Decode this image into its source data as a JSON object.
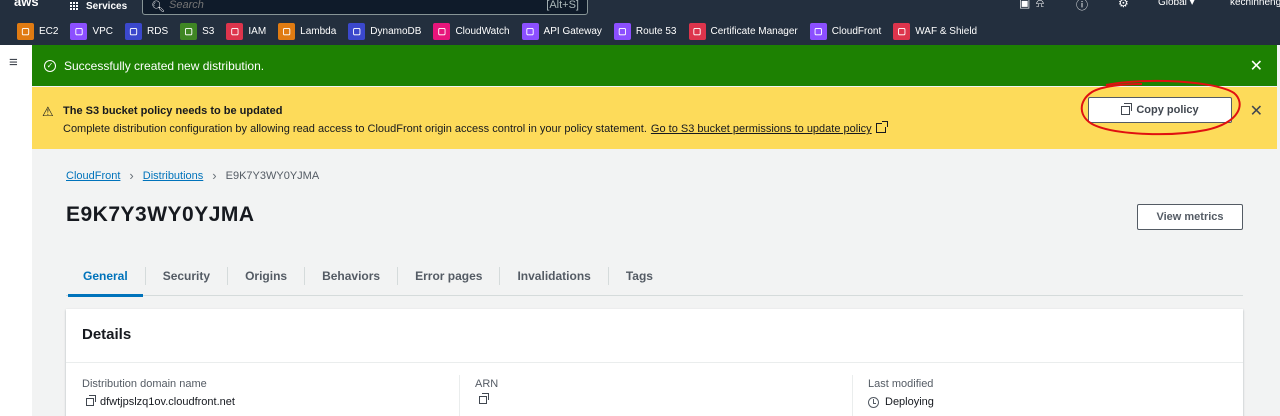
{
  "topnav": {
    "logo": "aws",
    "services_label": "Services",
    "search_placeholder": "Search",
    "search_shortcut": "[Alt+S]",
    "region_label": "Global ▾",
    "user_label": "kechihheng"
  },
  "favorites": [
    {
      "label": "EC2",
      "icon": "ec2-icon",
      "color": "#e07b12"
    },
    {
      "label": "VPC",
      "icon": "vpc-icon",
      "color": "#8c4fff"
    },
    {
      "label": "RDS",
      "icon": "rds-icon",
      "color": "#3b48cc"
    },
    {
      "label": "S3",
      "icon": "s3-icon",
      "color": "#3f8624"
    },
    {
      "label": "IAM",
      "icon": "iam-icon",
      "color": "#dd344c"
    },
    {
      "label": "Lambda",
      "icon": "lambda-icon",
      "color": "#e07b12"
    },
    {
      "label": "DynamoDB",
      "icon": "dynamodb-icon",
      "color": "#3b48cc"
    },
    {
      "label": "CloudWatch",
      "icon": "cloudwatch-icon",
      "color": "#e7157b"
    },
    {
      "label": "API Gateway",
      "icon": "api-gateway-icon",
      "color": "#8c4fff"
    },
    {
      "label": "Route 53",
      "icon": "route53-icon",
      "color": "#8c4fff"
    },
    {
      "label": "Certificate Manager",
      "icon": "certificate-manager-icon",
      "color": "#dd344c"
    },
    {
      "label": "CloudFront",
      "icon": "cloudfront-icon",
      "color": "#8c4fff"
    },
    {
      "label": "WAF & Shield",
      "icon": "waf-shield-icon",
      "color": "#dd344c"
    }
  ],
  "flash_success": {
    "message": "Successfully created new distribution.",
    "color": "#1d8102"
  },
  "flash_warning": {
    "title": "The S3 bucket policy needs to be updated",
    "message": "Complete distribution configuration by allowing read access to CloudFront origin access control in your policy statement.",
    "link": "Go to S3 bucket permissions to update policy",
    "button": "Copy policy",
    "color": "#fddb5a"
  },
  "breadcrumb": {
    "root": "CloudFront",
    "parent": "Distributions",
    "current": "E9K7Y3WY0YJMA"
  },
  "page": {
    "title": "E9K7Y3WY0YJMA",
    "view_metrics": "View metrics"
  },
  "tabs": [
    {
      "label": "General",
      "active": true
    },
    {
      "label": "Security",
      "active": false
    },
    {
      "label": "Origins",
      "active": false
    },
    {
      "label": "Behaviors",
      "active": false
    },
    {
      "label": "Error pages",
      "active": false
    },
    {
      "label": "Invalidations",
      "active": false
    },
    {
      "label": "Tags",
      "active": false
    }
  ],
  "details": {
    "header": "Details",
    "domain_label": "Distribution domain name",
    "domain_value": "dfwtjpslzq1ov.cloudfront.net",
    "arn_label": "ARN",
    "arn_value": "",
    "modified_label": "Last modified",
    "modified_value": "Deploying"
  },
  "colors": {
    "link": "#0073bb",
    "nav_bg": "#232f3e"
  }
}
